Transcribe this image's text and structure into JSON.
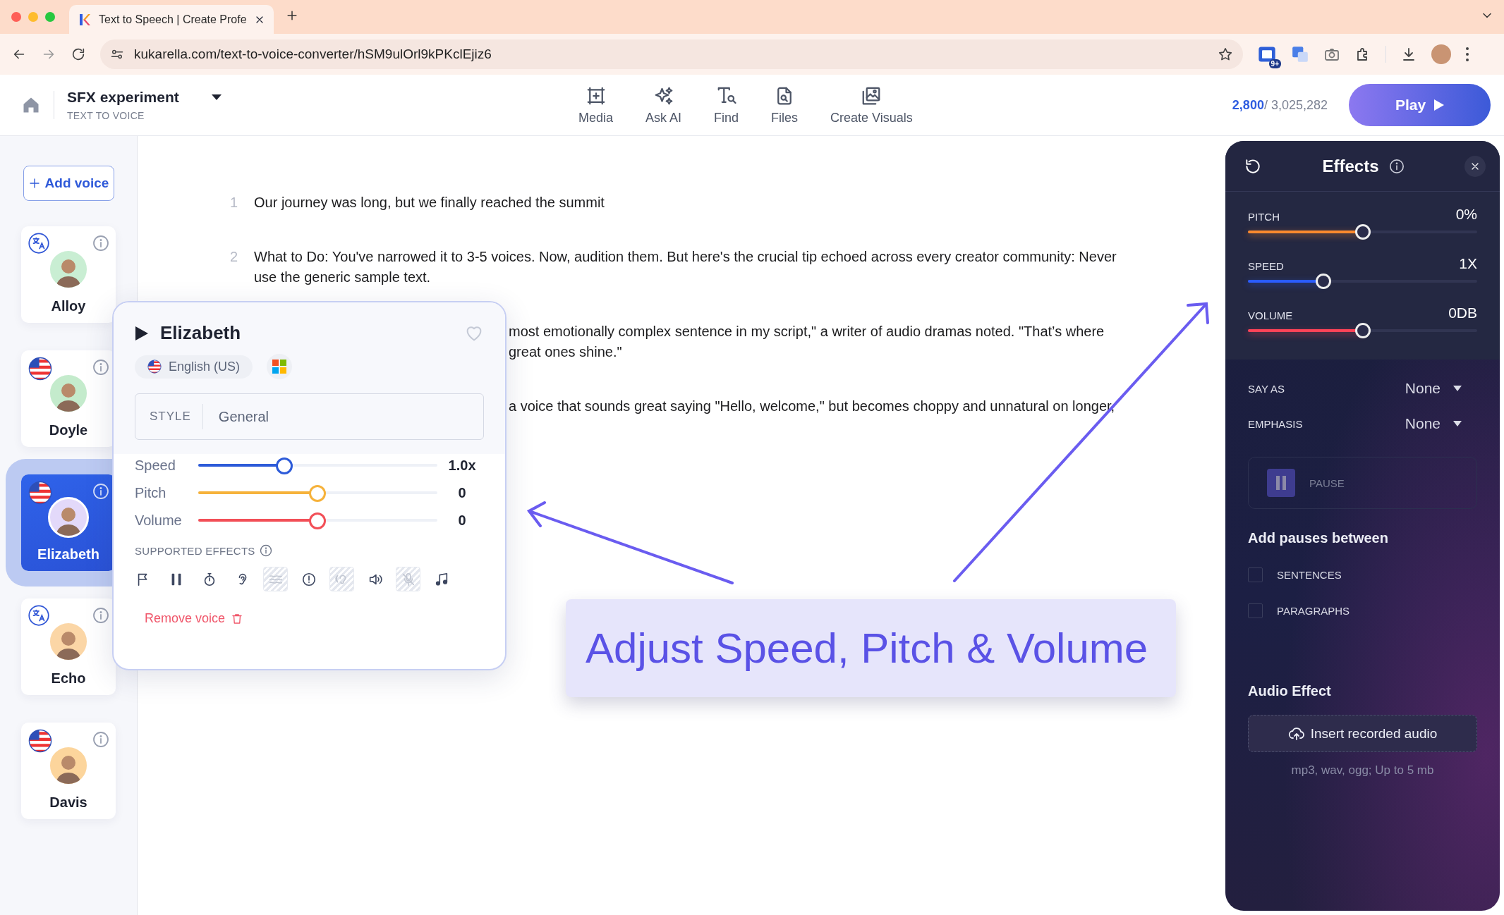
{
  "browser": {
    "tab": {
      "title": "Text to Speech | Create Profe"
    },
    "url": "kukarella.com/text-to-voice-converter/hSM9ulOrl9kPKclEjiz6",
    "extension_badge": "9+"
  },
  "header": {
    "project": "SFX experiment",
    "subtitle": "TEXT TO VOICE",
    "tools": [
      {
        "kind": "media",
        "label": "Media"
      },
      {
        "kind": "ai",
        "label": "Ask AI"
      },
      {
        "kind": "find",
        "label": "Find"
      },
      {
        "kind": "files",
        "label": "Files"
      },
      {
        "kind": "visuals",
        "label": "Create Visuals"
      }
    ],
    "credits_used": "2,800",
    "credits_total": "/ 3,025,282",
    "play": "Play"
  },
  "sidebar": {
    "add_voice": "Add voice",
    "voices": [
      {
        "name": "Alloy",
        "kind": "translate",
        "selected": false,
        "color": "#c9eed3"
      },
      {
        "name": "Doyle",
        "kind": "flag",
        "selected": false,
        "color": "#c4ebcc"
      },
      {
        "name": "Elizabeth",
        "kind": "flag",
        "selected": true,
        "color": "#e3d9fa"
      },
      {
        "name": "Echo",
        "kind": "translate",
        "selected": false,
        "color": "#fbd6a6"
      },
      {
        "name": "Davis",
        "kind": "flag",
        "selected": false,
        "color": "#fcd59c"
      }
    ]
  },
  "editor": {
    "lines": [
      {
        "number": "1",
        "text": "Our journey was long, but we finally reached the summit"
      },
      {
        "number": "2",
        "text": "What to Do: You've narrowed it to 3-5 voices. Now, audition them. But here's the crucial tip echoed across every creator community: Never use the generic sample text."
      },
      {
        "text": "most emotionally complex sentence in my script,\" a writer of audio dramas noted. \"That’s where\ngreat ones shine.\""
      },
      {
        "text": "a voice that sounds great saying \"Hello, welcome,\" but becomes choppy and unnatural on longer,"
      }
    ]
  },
  "voice_popup": {
    "name": "Elizabeth",
    "language": "English (US)",
    "style_label": "STYLE",
    "style": "General",
    "sliders": [
      {
        "label": "Speed",
        "level": 0.36,
        "reading": "1.0x",
        "color": "#2d5bd9"
      },
      {
        "label": "Pitch",
        "level": 0.5,
        "reading": "0",
        "color": "#f6b23b"
      },
      {
        "label": "Volume",
        "level": 0.5,
        "reading": "0",
        "color": "#f24f57"
      }
    ],
    "effects_title": "SUPPORTED EFFECTS",
    "effects": [
      {
        "kind": "flag",
        "disabled": false
      },
      {
        "kind": "pause",
        "disabled": false
      },
      {
        "kind": "stopwatch",
        "disabled": false
      },
      {
        "kind": "ear",
        "disabled": false
      },
      {
        "kind": "waves",
        "disabled": true
      },
      {
        "kind": "alert",
        "disabled": false
      },
      {
        "kind": "ear-waves",
        "disabled": true
      },
      {
        "kind": "speaker",
        "disabled": false
      },
      {
        "kind": "mic-off",
        "disabled": true
      },
      {
        "kind": "music",
        "disabled": false
      }
    ],
    "remove": "Remove voice"
  },
  "caption": "Adjust Speed, Pitch & Volume",
  "effects_panel": {
    "title": "Effects",
    "sliders": [
      {
        "label": "PITCH",
        "reading": "0%",
        "level": 0.5,
        "color": "#ff8a2e"
      },
      {
        "label": "SPEED",
        "reading": "1X",
        "level": 0.33,
        "color": "#2a5cff"
      },
      {
        "label": "VOLUME",
        "reading": "0DB",
        "level": 0.5,
        "color": "#ff4358"
      }
    ],
    "dropdowns": [
      {
        "label": "SAY AS",
        "value": "None"
      },
      {
        "label": "EMPHASIS",
        "value": "None"
      }
    ],
    "pause": "PAUSE",
    "pauses_title": "Add pauses between",
    "checkboxes": [
      {
        "label": "SENTENCES",
        "checked": false
      },
      {
        "label": "PARAGRAPHS",
        "checked": false
      }
    ],
    "audio_title": "Audio Effect",
    "upload": "Insert recorded audio",
    "upload_hint": "mp3, wav, ogg; Up to 5 mb"
  }
}
